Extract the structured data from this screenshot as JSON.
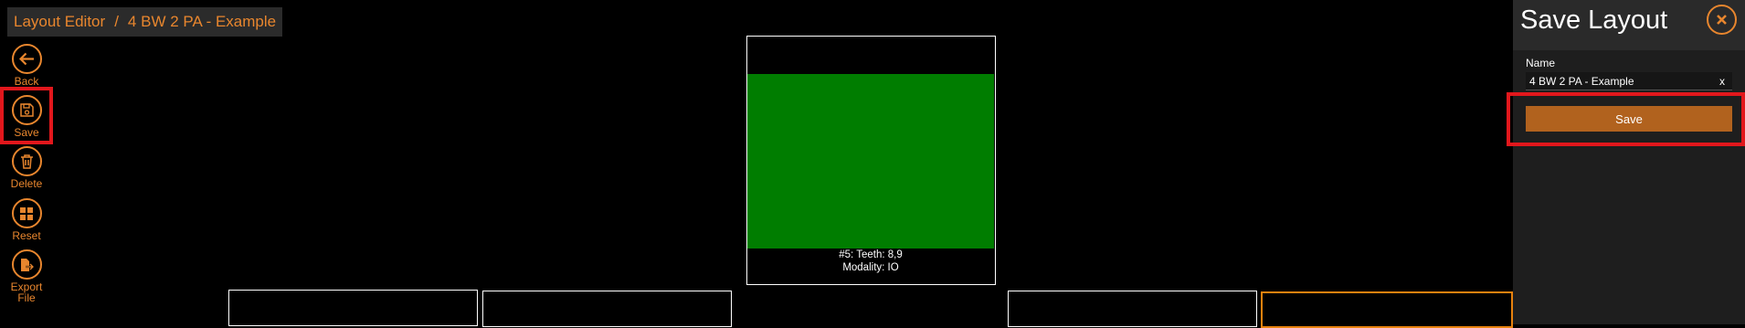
{
  "breadcrumb": {
    "app": "Layout Editor",
    "separator": "/",
    "layout": "4 BW 2 PA - Example"
  },
  "toolbar": {
    "back": "Back",
    "save": "Save",
    "delete": "Delete",
    "reset": "Reset",
    "export_line1": "Export",
    "export_line2": "File"
  },
  "canvas": {
    "cells": [
      {
        "id": "#5",
        "caption_line1": "#5: Teeth: 8,9",
        "caption_line2": "Modality: IO"
      }
    ]
  },
  "save_panel": {
    "title": "Save Layout",
    "name_label": "Name",
    "name_value": "4 BW 2 PA - Example",
    "clear_glyph": "x",
    "save_label": "Save"
  },
  "colors": {
    "accent": "#e8862e",
    "save_button": "#b1621e",
    "highlight": "#e2171c",
    "image_fill": "#007d00"
  }
}
